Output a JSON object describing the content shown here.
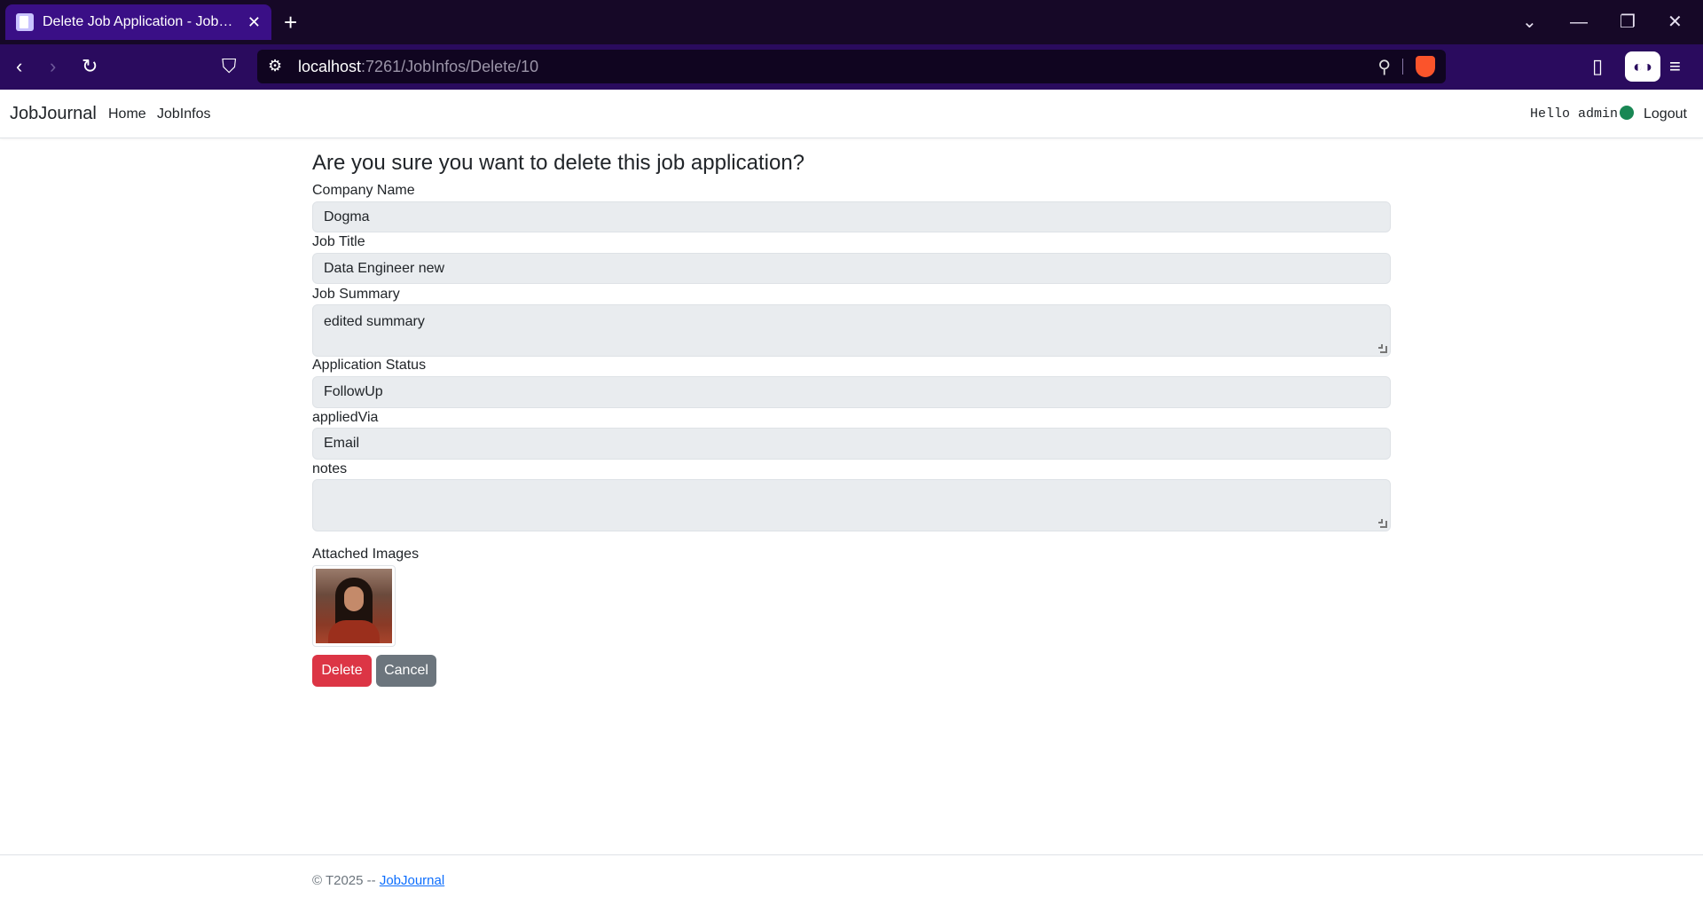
{
  "browser": {
    "tab_title": "Delete Job Application - JobJournal",
    "url_host": "localhost",
    "url_rest": ":7261/JobInfos/Delete/10"
  },
  "navbar": {
    "brand": "JobJournal",
    "links": [
      "Home",
      "JobInfos"
    ],
    "greeting": "Hello admin!",
    "logout": "Logout",
    "status_color": "#198754"
  },
  "page": {
    "heading": "Are you sure you want to delete this job application?",
    "fields": [
      {
        "label": "Company Name",
        "value": "Dogma"
      },
      {
        "label": "Job Title",
        "value": "Data Engineer new"
      },
      {
        "label": "Job Summary",
        "value": "edited summary"
      },
      {
        "label": "Application Status",
        "value": "FollowUp"
      },
      {
        "label": "appliedVia",
        "value": "Email"
      },
      {
        "label": "notes",
        "value": ""
      }
    ],
    "attachments_label": "Attached Images",
    "delete_label": "Delete",
    "cancel_label": "Cancel"
  },
  "footer": {
    "text": "© T2025 -- ",
    "link": "JobJournal"
  },
  "colors": {
    "danger": "#dc3545",
    "secondary": "#6c757d",
    "link": "#0d6efd"
  }
}
